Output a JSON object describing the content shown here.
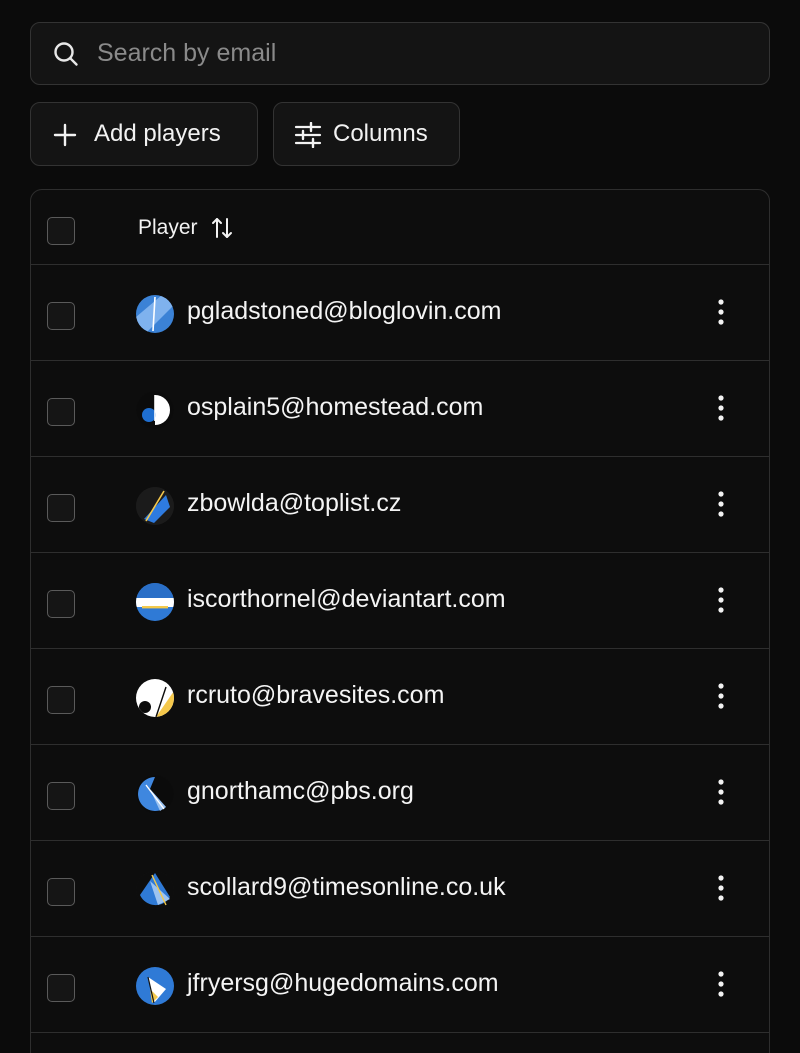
{
  "search": {
    "icon": "search-icon",
    "placeholder": "Search by email",
    "value": ""
  },
  "toolbar": {
    "add_label": "Add players",
    "add_icon": "plus-icon",
    "columns_label": "Columns",
    "columns_icon": "sliders-icon"
  },
  "table": {
    "header": {
      "player_label": "Player",
      "sort_icon": "sort-arrows-icon"
    },
    "rows": [
      {
        "email": "pgladstoned@bloglovin.com",
        "avatar_colors": [
          "#3b82d6",
          "#7fb2ee",
          "#ffffff"
        ]
      },
      {
        "email": "osplain5@homestead.com",
        "avatar_colors": [
          "#ffffff",
          "#1f6fd1",
          "#0b0b0b"
        ]
      },
      {
        "email": "zbowlda@toplist.cz",
        "avatar_colors": [
          "#1b1b1b",
          "#2e7be0",
          "#f5c84b"
        ]
      },
      {
        "email": "iscorthornel@deviantart.com",
        "avatar_colors": [
          "#2f7ad6",
          "#ffffff",
          "#f3c94a"
        ]
      },
      {
        "email": "rcruto@bravesites.com",
        "avatar_colors": [
          "#ffffff",
          "#f5c84b",
          "#0b0b0b"
        ]
      },
      {
        "email": "gnorthamc@pbs.org",
        "avatar_colors": [
          "#3f87df",
          "#9cc3f1",
          "#0b0b0b"
        ]
      },
      {
        "email": "scollard9@timesonline.co.uk",
        "avatar_colors": [
          "#2f7ad6",
          "#9cc3f1",
          "#f3c94a"
        ]
      },
      {
        "email": "jfryersg@hugedomains.com",
        "avatar_colors": [
          "#2f7ad6",
          "#ffffff",
          "#f3c94a"
        ]
      }
    ],
    "row_menu_icon": "more-vertical-icon"
  },
  "colors": {
    "background": "#0b0b0b",
    "surface": "#141414",
    "border": "#2e2e2e",
    "text": "#f2f2f2",
    "placeholder": "#8a8a8a"
  }
}
